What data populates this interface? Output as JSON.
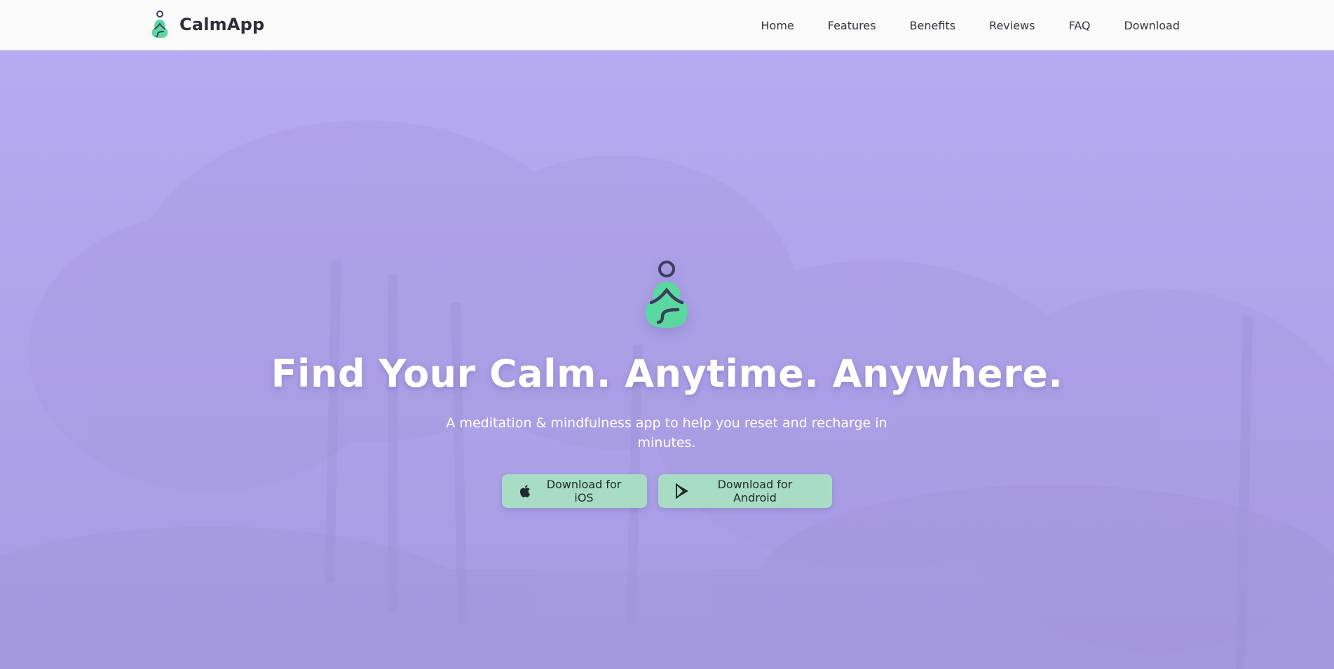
{
  "brand": {
    "name": "CalmApp"
  },
  "nav": {
    "items": [
      {
        "label": "Home"
      },
      {
        "label": "Features"
      },
      {
        "label": "Benefits"
      },
      {
        "label": "Reviews"
      },
      {
        "label": "FAQ"
      },
      {
        "label": "Download"
      }
    ]
  },
  "hero": {
    "title": "Find Your Calm. Anytime. Anywhere.",
    "subtitle": "A meditation & mindfulness app to help you reset and recharge in minutes.",
    "buttons": {
      "ios_label": "Download for iOS",
      "android_label": "Download for Android"
    }
  },
  "colors": {
    "accent_green": "#5ad8a0",
    "button_bg": "#a9dcc4",
    "hero_overlay": "#b6a9f0",
    "logo_dark": "#3a3e5c"
  },
  "icons": {
    "logo": "meditating-person-icon",
    "ios": "apple-icon",
    "android": "google-play-icon"
  }
}
